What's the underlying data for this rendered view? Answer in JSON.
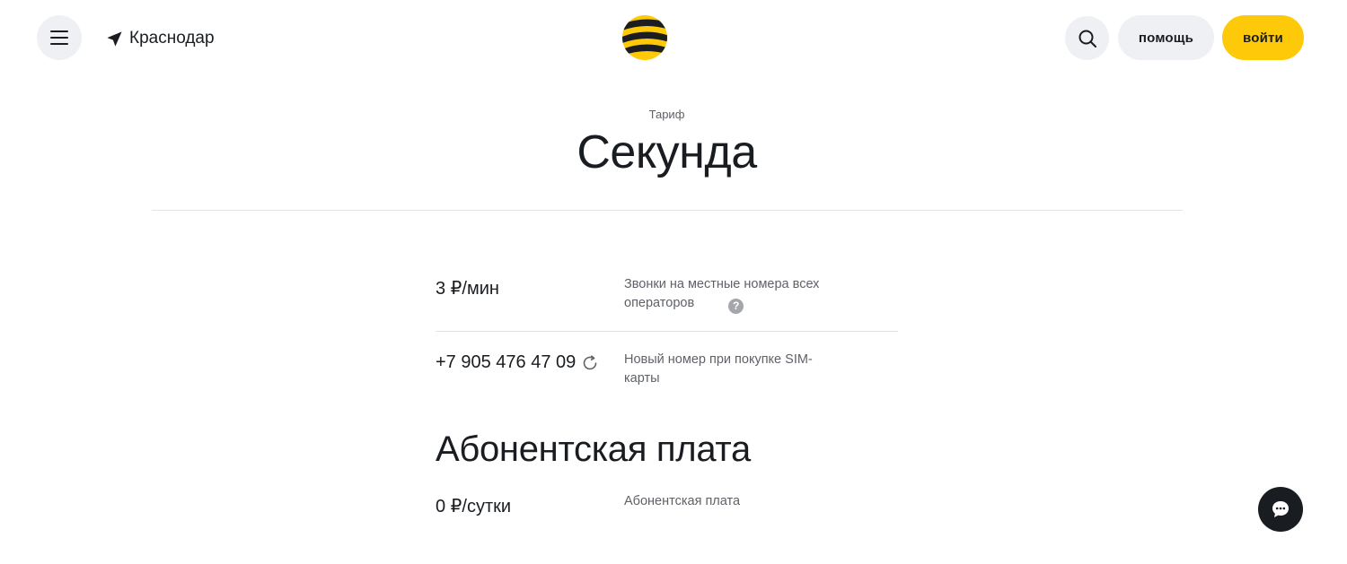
{
  "header": {
    "city": "Краснодар",
    "help_label": "помощь",
    "login_label": "войти",
    "icons": {
      "menu": "hamburger-menu-icon",
      "location": "location-arrow-icon",
      "logo": "beeline-logo",
      "search": "search-icon",
      "chat": "chat-bubble-icon"
    }
  },
  "tariff": {
    "eyebrow": "Тариф",
    "name": "Секунда"
  },
  "rows": [
    {
      "value": "3 ₽/мин",
      "description": "Звонки на местные номера всех операторов"
    },
    {
      "value": "+7 905 476 47 09",
      "description": "Новый номер при покупке SIM-карты"
    }
  ],
  "subscription": {
    "title": "Абонентская плата",
    "value": "0 ₽/сутки",
    "description": "Абонентская плата"
  },
  "colors": {
    "accent_yellow": "#fec909",
    "text_dark": "#191c20",
    "text_muted": "#5e6268",
    "button_grey": "#eef0f3"
  }
}
